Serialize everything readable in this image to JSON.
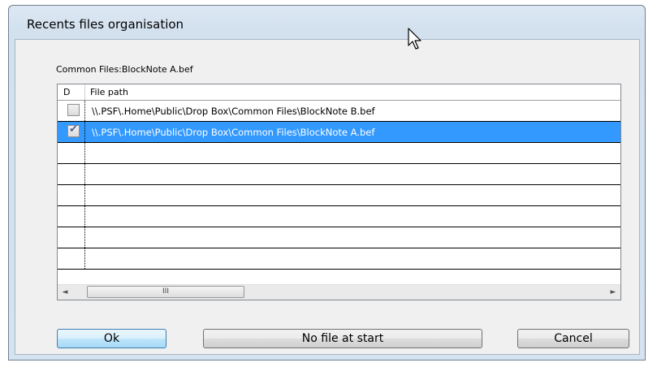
{
  "window": {
    "title": "Recents files organisation"
  },
  "current_file_label": "Common Files:BlockNote A.bef",
  "table": {
    "columns": [
      "D",
      "File path"
    ],
    "rows": [
      {
        "checked": false,
        "selected": false,
        "path": "\\\\.PSF\\.Home\\Public\\Drop Box\\Common Files\\BlockNote B.bef"
      },
      {
        "checked": true,
        "selected": true,
        "path": "\\\\.PSF\\.Home\\Public\\Drop Box\\Common Files\\BlockNote A.bef"
      },
      {
        "checked": false,
        "selected": false,
        "path": ""
      },
      {
        "checked": false,
        "selected": false,
        "path": ""
      },
      {
        "checked": false,
        "selected": false,
        "path": ""
      },
      {
        "checked": false,
        "selected": false,
        "path": ""
      },
      {
        "checked": false,
        "selected": false,
        "path": ""
      },
      {
        "checked": false,
        "selected": false,
        "path": ""
      }
    ],
    "scroll_thumb_glyph": "III",
    "scroll_left_glyph": "◄",
    "scroll_right_glyph": "►"
  },
  "buttons": {
    "ok": "Ok",
    "no_file": "No file at start",
    "cancel": "Cancel"
  },
  "icons": {
    "checkmark": "checkmark-icon",
    "cursor": "mouse-pointer-icon"
  },
  "colors": {
    "selection": "#3399ff",
    "window_frame": "#d3e1ef",
    "client_bg": "#f0f0f0"
  }
}
